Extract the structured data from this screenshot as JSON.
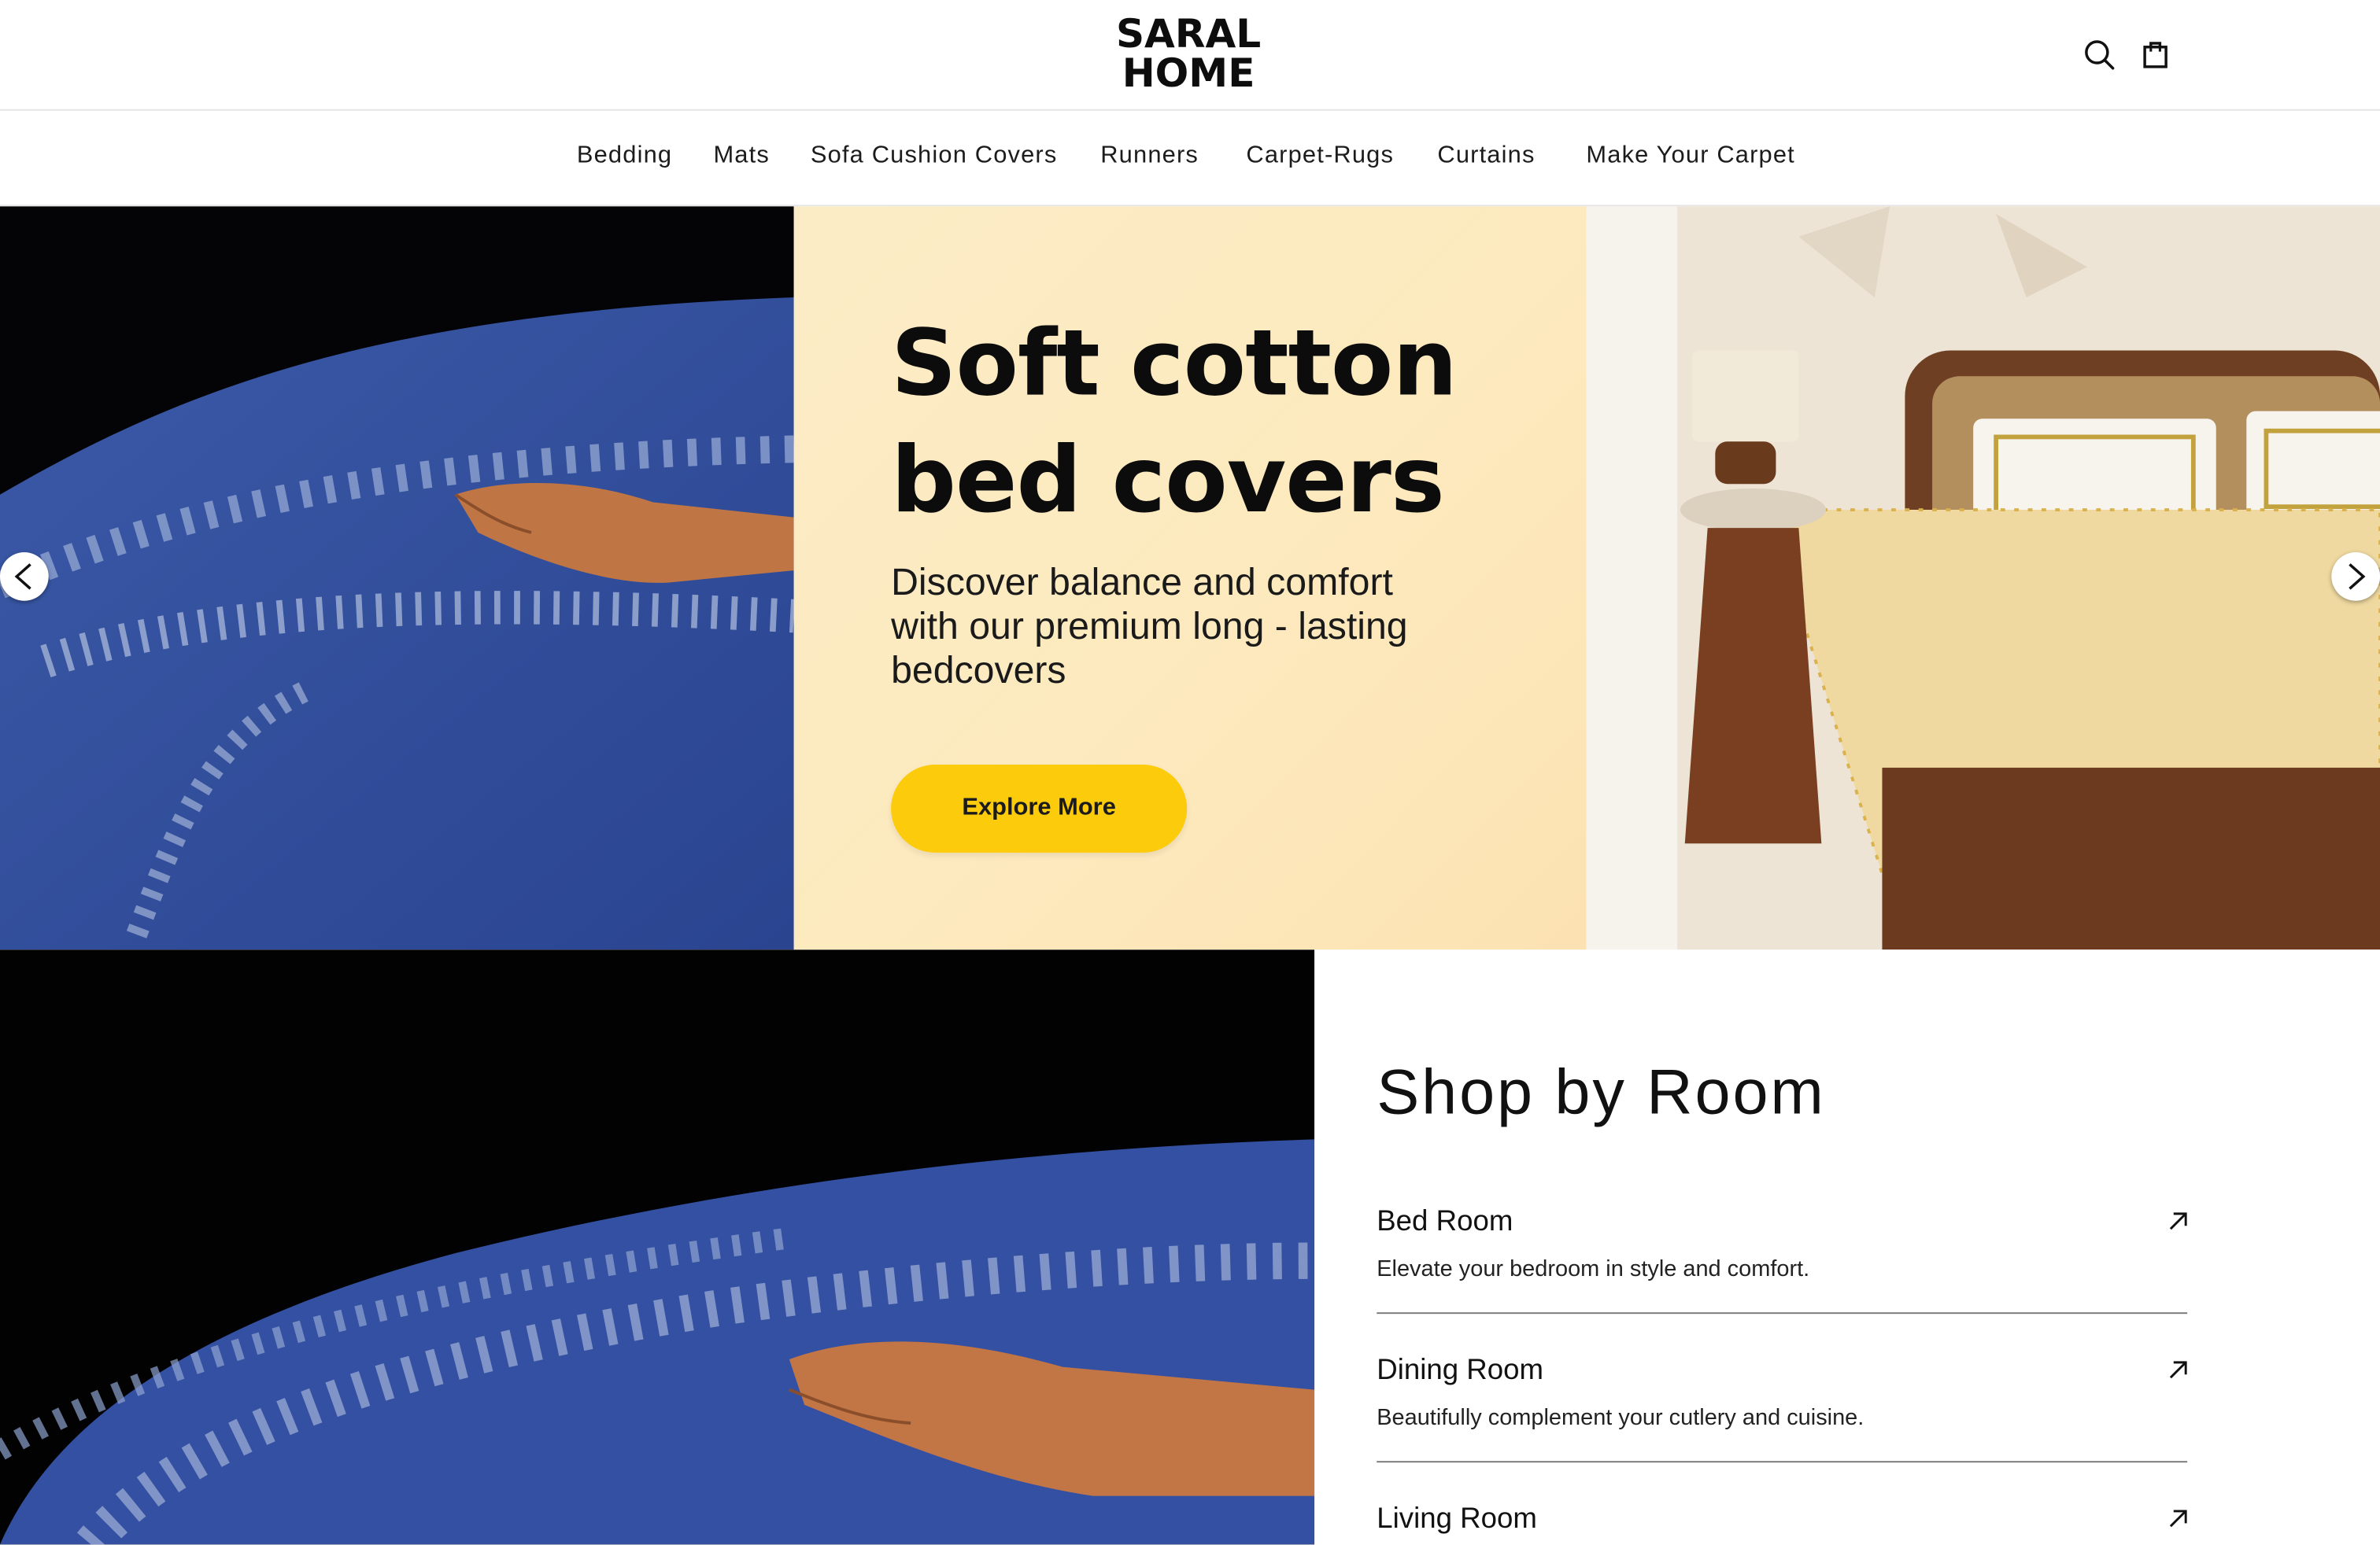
{
  "brand": {
    "logo_line1": "SARAL",
    "logo_line2": "HOME"
  },
  "header": {
    "icons": [
      "search-icon",
      "shopping-bag-icon"
    ]
  },
  "nav": {
    "items": [
      "Bedding",
      "Mats",
      "Sofa Cushion Covers",
      "Runners",
      "Carpet-Rugs",
      "Curtains",
      "Make Your Carpet"
    ]
  },
  "hero": {
    "title_line1": "Soft cotton",
    "title_line2": "bed covers",
    "subtitle": "Discover balance and comfort with our premium long - lasting bedcovers",
    "cta_label": "Explore More",
    "colors": {
      "cta": "#fccb0c",
      "panel": "#fdeac2"
    }
  },
  "shop_by_room": {
    "title": "Shop by Room",
    "rooms": [
      {
        "name": "Bed Room",
        "description": "Elevate your bedroom in style and comfort."
      },
      {
        "name": "Dining Room",
        "description": "Beautifully complement your cutlery and cuisine."
      },
      {
        "name": "Living Room",
        "description": ""
      }
    ]
  }
}
